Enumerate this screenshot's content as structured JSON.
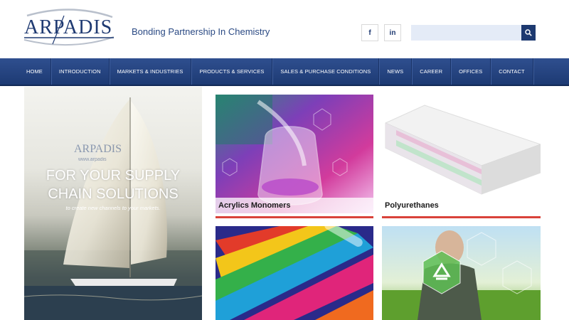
{
  "header": {
    "logo_text": "ARPADIS",
    "tagline": "Bonding Partnership In Chemistry",
    "social": {
      "facebook": "f",
      "linkedin": "in"
    },
    "search": {
      "placeholder": "",
      "icon": "search-icon"
    }
  },
  "nav": {
    "items": [
      {
        "label": "HOME"
      },
      {
        "label": "INTRODUCTION"
      },
      {
        "label": "MARKETS & INDUSTRIES"
      },
      {
        "label": "PRODUCTS & SERVICES"
      },
      {
        "label": "SALES & PURCHASE CONDITIONS"
      },
      {
        "label": "NEWS"
      },
      {
        "label": "CAREER"
      },
      {
        "label": "OFFICES"
      },
      {
        "label": "CONTACT"
      }
    ]
  },
  "hero": {
    "headline_line1": "FOR YOUR SUPPLY",
    "headline_line2": "CHAIN SOLUTIONS",
    "subline": "to create new channels to your markets.",
    "sail_text": "ARPADIS",
    "sail_url": "www.arpadis"
  },
  "tiles": [
    {
      "title": "Acrylics Monomers"
    },
    {
      "title": "Polyurethanes"
    },
    {
      "title": ""
    },
    {
      "title": ""
    }
  ],
  "colors": {
    "brand_blue": "#1d3970",
    "accent_red": "#d9423a",
    "search_bg": "#e4ebf7"
  }
}
